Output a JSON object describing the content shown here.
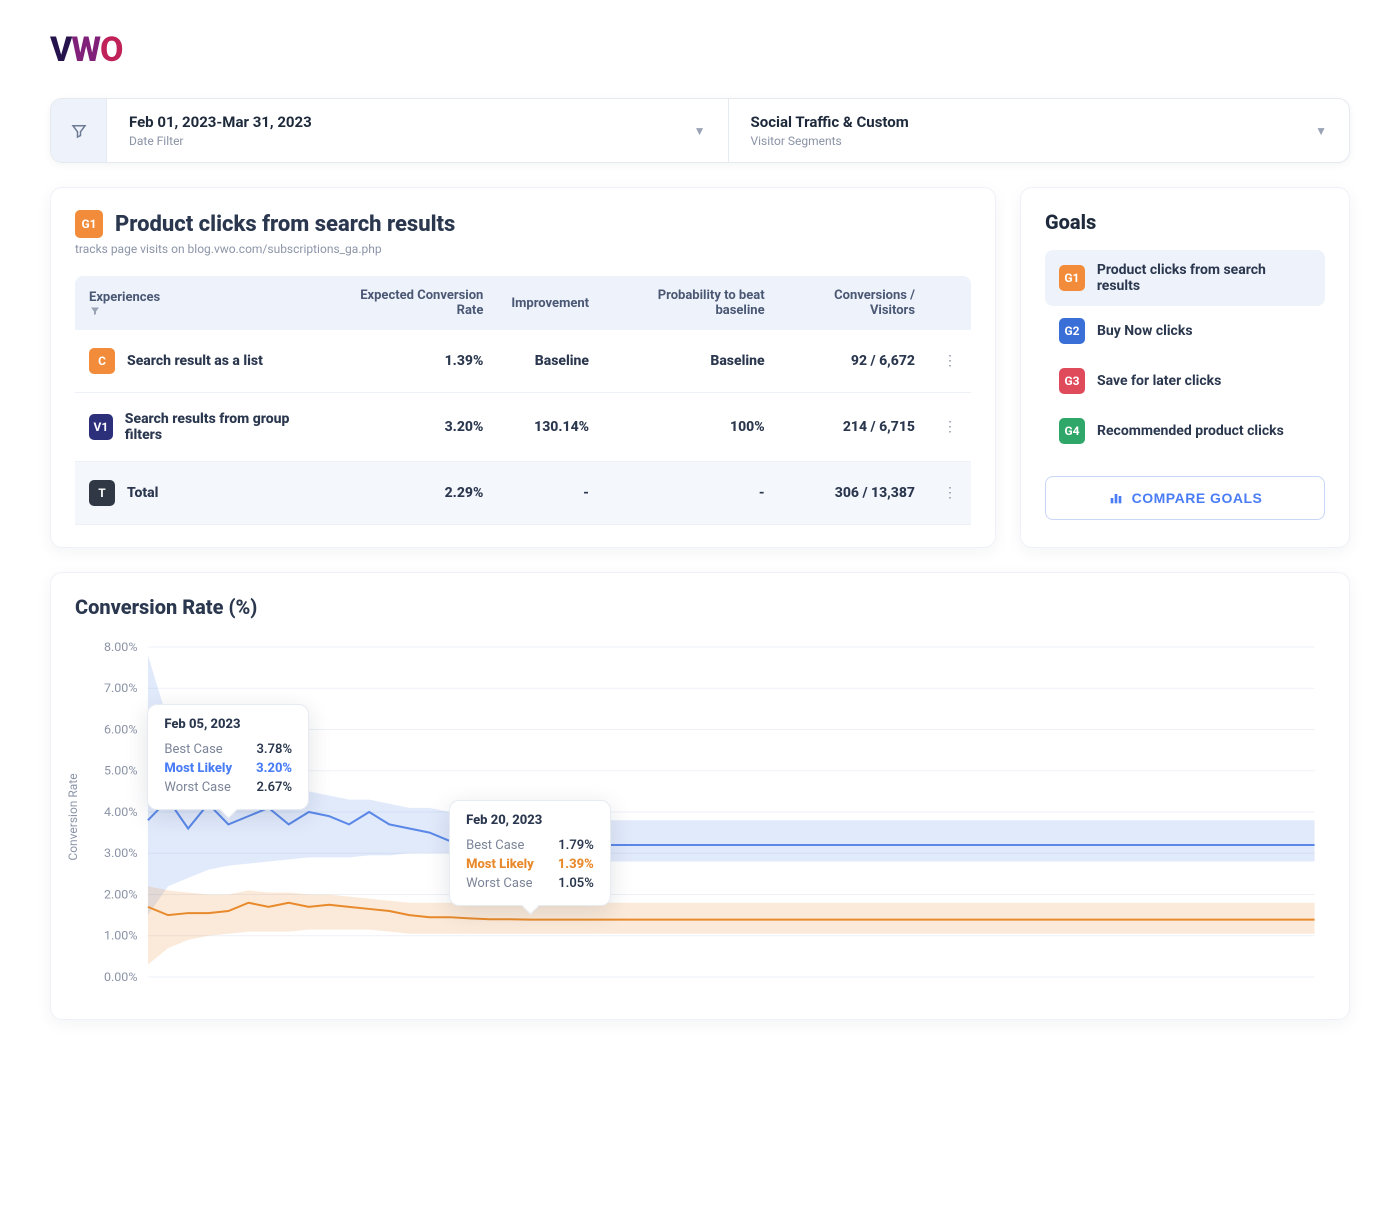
{
  "logo": {
    "letters": [
      "V",
      "W",
      "O"
    ]
  },
  "filters": {
    "date": {
      "value": "Feb 01, 2023-Mar 31, 2023",
      "label": "Date Filter"
    },
    "segments": {
      "value": "Social Traffic & Custom",
      "label": "Visitor Segments"
    }
  },
  "goal_card": {
    "badge": "G1",
    "title": "Product clicks from search results",
    "description": "tracks page visits on blog.vwo.com/subscriptions_ga.php",
    "columns": {
      "experiences": "Experiences",
      "ecr": "Expected Conversion Rate",
      "improvement": "Improvement",
      "p2b": "Probability to beat baseline",
      "conv": "Conversions / Visitors"
    },
    "rows": [
      {
        "badge": "C",
        "badgeClass": "b-orange",
        "name": "Search result as a list",
        "ecr": "1.39%",
        "improvement": "Baseline",
        "p2b": "Baseline",
        "conv": "92 / 6,672"
      },
      {
        "badge": "V1",
        "badgeClass": "b-navy",
        "name": "Search results from group filters",
        "ecr": "3.20%",
        "improvement": "130.14%",
        "p2b": "100%",
        "conv": "214 / 6,715"
      },
      {
        "badge": "T",
        "badgeClass": "b-dark",
        "name": "Total",
        "ecr": "2.29%",
        "improvement": "-",
        "p2b": "-",
        "conv": "306 / 13,387",
        "total": true
      }
    ]
  },
  "goals_sidebar": {
    "title": "Goals",
    "items": [
      {
        "badge": "G1",
        "badgeClass": "b-orange",
        "label": "Product clicks from search results",
        "active": true
      },
      {
        "badge": "G2",
        "badgeClass": "b-blue",
        "label": "Buy Now clicks"
      },
      {
        "badge": "G3",
        "badgeClass": "b-red",
        "label": "Save for later clicks"
      },
      {
        "badge": "G4",
        "badgeClass": "b-green",
        "label": "Recommended product clicks"
      }
    ],
    "compare_label": "COMPARE GOALS"
  },
  "chart_data": {
    "type": "line",
    "title": "Conversion Rate (%)",
    "ylabel": "Conversion Rate",
    "xlabel": "",
    "ylim": [
      0,
      8
    ],
    "yticks": [
      "0.00%",
      "1.00%",
      "2.00%",
      "3.00%",
      "4.00%",
      "5.00%",
      "6.00%",
      "7.00%",
      "8.00%"
    ],
    "x_days": 59,
    "series": [
      {
        "name": "V1 (blue)",
        "color": "#5b88e8",
        "values": [
          3.8,
          4.3,
          3.6,
          4.2,
          3.7,
          3.9,
          4.1,
          3.7,
          4.0,
          3.9,
          3.7,
          4.0,
          3.7,
          3.6,
          3.5,
          3.3,
          3.2,
          3.2,
          3.2,
          3.2,
          3.2,
          3.2,
          3.2,
          3.2,
          3.2,
          3.2,
          3.2,
          3.2,
          3.2,
          3.2,
          3.2,
          3.2,
          3.2,
          3.2,
          3.2,
          3.2,
          3.2,
          3.2,
          3.2,
          3.2,
          3.2,
          3.2,
          3.2,
          3.2,
          3.2,
          3.2,
          3.2,
          3.2,
          3.2,
          3.2,
          3.2,
          3.2,
          3.2,
          3.2,
          3.2,
          3.2,
          3.2,
          3.2,
          3.2
        ],
        "band_upper": [
          7.8,
          6.2,
          5.5,
          5.2,
          5.0,
          4.8,
          4.7,
          4.6,
          4.5,
          4.4,
          4.3,
          4.3,
          4.2,
          4.1,
          4.1,
          4.0,
          4.0,
          3.95,
          3.9,
          3.9,
          3.85,
          3.85,
          3.8,
          3.8,
          3.8,
          3.8,
          3.8,
          3.8,
          3.8,
          3.8,
          3.8,
          3.8,
          3.8,
          3.8,
          3.8,
          3.8,
          3.8,
          3.8,
          3.8,
          3.8,
          3.8,
          3.8,
          3.8,
          3.8,
          3.8,
          3.8,
          3.8,
          3.8,
          3.8,
          3.8,
          3.8,
          3.8,
          3.8,
          3.8,
          3.8,
          3.8,
          3.8,
          3.8,
          3.8
        ],
        "band_lower": [
          1.5,
          2.2,
          2.4,
          2.6,
          2.7,
          2.75,
          2.8,
          2.85,
          2.9,
          2.9,
          2.9,
          2.95,
          2.95,
          3.0,
          3.0,
          3.0,
          2.9,
          2.85,
          2.8,
          2.8,
          2.8,
          2.8,
          2.8,
          2.8,
          2.8,
          2.8,
          2.8,
          2.8,
          2.8,
          2.8,
          2.8,
          2.8,
          2.8,
          2.8,
          2.8,
          2.8,
          2.8,
          2.8,
          2.8,
          2.8,
          2.8,
          2.8,
          2.8,
          2.8,
          2.8,
          2.8,
          2.8,
          2.8,
          2.8,
          2.8,
          2.8,
          2.8,
          2.8,
          2.8,
          2.8,
          2.8,
          2.8,
          2.8,
          2.8
        ]
      },
      {
        "name": "C (orange)",
        "color": "#e88a2c",
        "values": [
          1.7,
          1.5,
          1.55,
          1.55,
          1.6,
          1.8,
          1.7,
          1.8,
          1.7,
          1.75,
          1.7,
          1.65,
          1.6,
          1.5,
          1.45,
          1.45,
          1.42,
          1.4,
          1.4,
          1.39,
          1.39,
          1.39,
          1.39,
          1.39,
          1.39,
          1.39,
          1.39,
          1.39,
          1.39,
          1.39,
          1.39,
          1.39,
          1.39,
          1.39,
          1.39,
          1.39,
          1.39,
          1.39,
          1.39,
          1.39,
          1.39,
          1.39,
          1.39,
          1.39,
          1.39,
          1.39,
          1.39,
          1.39,
          1.39,
          1.39,
          1.39,
          1.39,
          1.39,
          1.39,
          1.39,
          1.39,
          1.39,
          1.39,
          1.39
        ],
        "band_upper": [
          2.2,
          2.1,
          2.05,
          2.0,
          2.0,
          2.1,
          2.05,
          2.05,
          2.0,
          2.0,
          1.95,
          1.9,
          1.85,
          1.8,
          1.8,
          1.8,
          1.8,
          1.8,
          1.8,
          1.8,
          1.8,
          1.8,
          1.8,
          1.8,
          1.8,
          1.8,
          1.8,
          1.8,
          1.8,
          1.8,
          1.8,
          1.8,
          1.8,
          1.8,
          1.8,
          1.8,
          1.8,
          1.8,
          1.8,
          1.8,
          1.8,
          1.8,
          1.8,
          1.8,
          1.8,
          1.8,
          1.8,
          1.8,
          1.8,
          1.8,
          1.8,
          1.8,
          1.8,
          1.8,
          1.8,
          1.8,
          1.8,
          1.8,
          1.8
        ],
        "band_lower": [
          0.3,
          0.7,
          0.9,
          1.0,
          1.05,
          1.1,
          1.1,
          1.1,
          1.15,
          1.15,
          1.15,
          1.15,
          1.1,
          1.05,
          1.05,
          1.05,
          1.05,
          1.05,
          1.05,
          1.05,
          1.05,
          1.05,
          1.05,
          1.05,
          1.05,
          1.05,
          1.05,
          1.05,
          1.05,
          1.05,
          1.05,
          1.05,
          1.05,
          1.05,
          1.05,
          1.05,
          1.05,
          1.05,
          1.05,
          1.05,
          1.05,
          1.05,
          1.05,
          1.05,
          1.05,
          1.05,
          1.05,
          1.05,
          1.05,
          1.05,
          1.05,
          1.05,
          1.05,
          1.05,
          1.05,
          1.05,
          1.05,
          1.05,
          1.05
        ]
      }
    ],
    "tooltips": [
      {
        "date": "Feb 05, 2023",
        "day_index": 4,
        "color": "blue",
        "rows": [
          {
            "label": "Best Case",
            "value": "3.78%"
          },
          {
            "label": "Most Likely",
            "value": "3.20%",
            "highlight": true
          },
          {
            "label": "Worst Case",
            "value": "2.67%"
          }
        ]
      },
      {
        "date": "Feb 20, 2023",
        "day_index": 19,
        "color": "orange",
        "rows": [
          {
            "label": "Best Case",
            "value": "1.79%"
          },
          {
            "label": "Most Likely",
            "value": "1.39%",
            "highlight": true
          },
          {
            "label": "Worst Case",
            "value": "1.05%"
          }
        ]
      }
    ]
  }
}
